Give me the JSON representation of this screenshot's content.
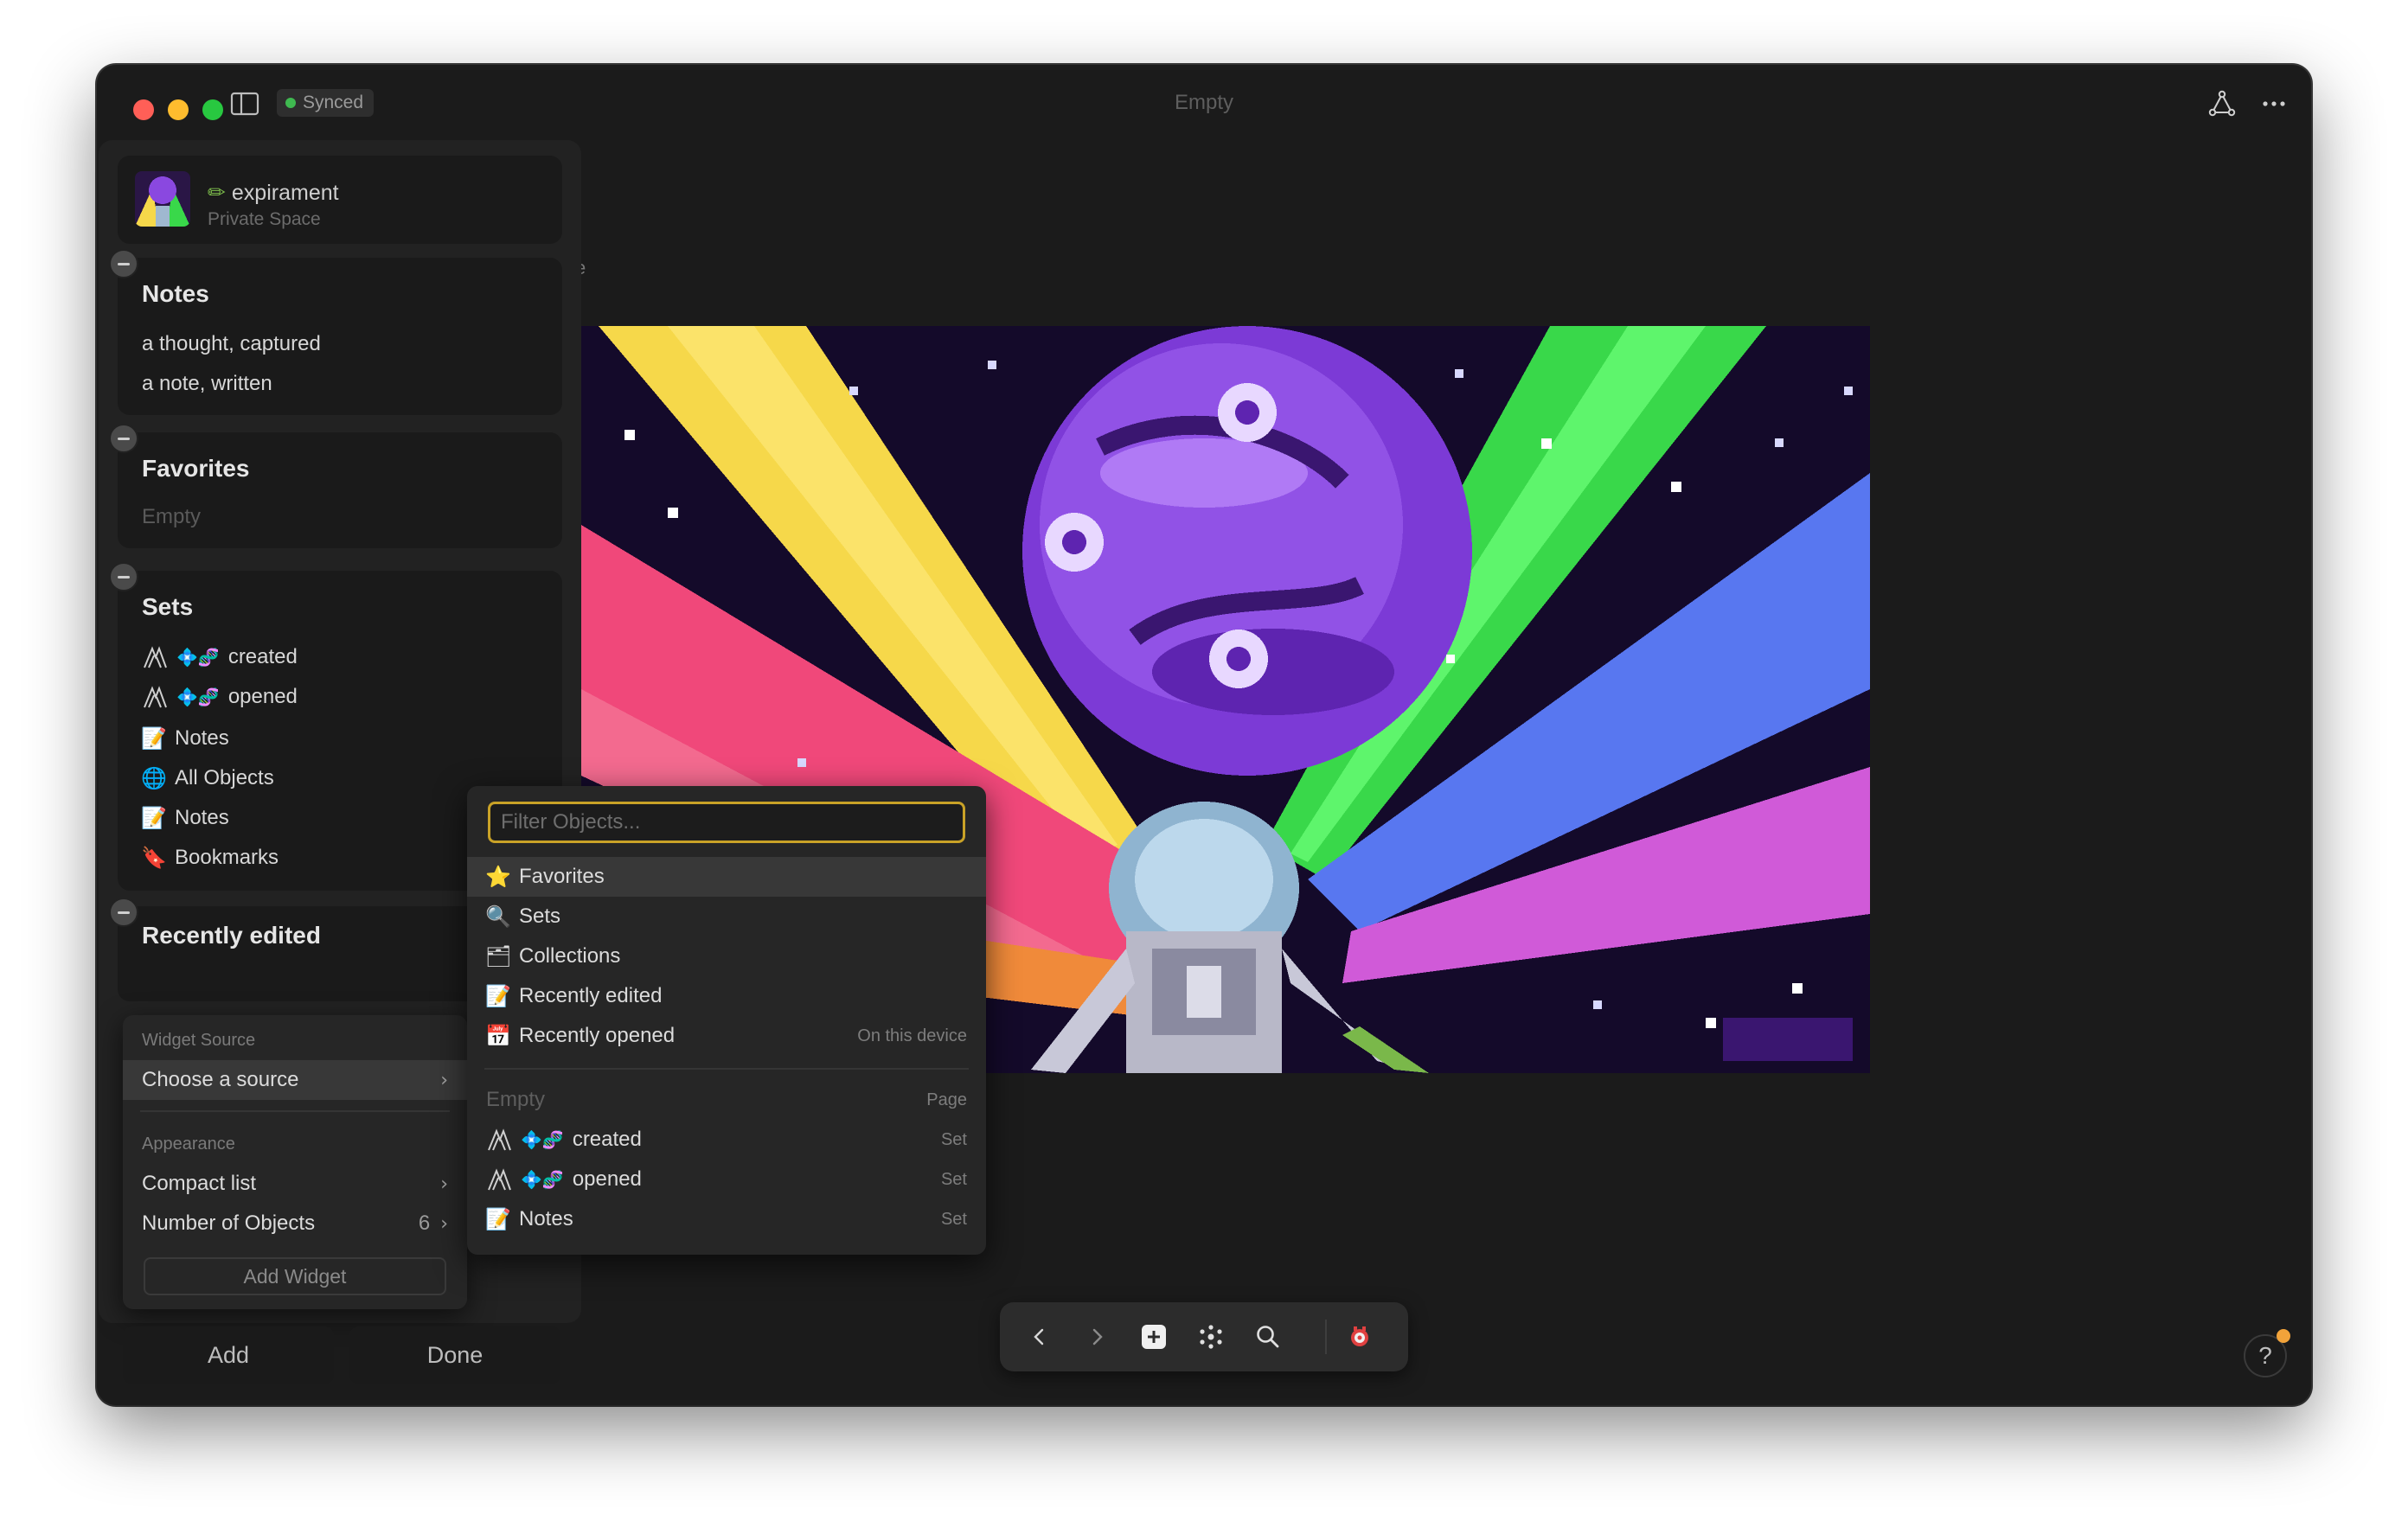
{
  "window": {
    "title": "Empty",
    "sync_status": "Synced"
  },
  "space": {
    "name": "expirament",
    "name_prefix": "✏",
    "subtitle": "Private Space"
  },
  "widgets": {
    "notes": {
      "title": "Notes",
      "items": [
        "a thought, captured",
        "a note, written"
      ]
    },
    "favorites": {
      "title": "Favorites",
      "empty_text": "Empty"
    },
    "sets": {
      "title": "Sets",
      "items": [
        {
          "icons": "💠🧬",
          "label": "created",
          "emoji": "📝"
        },
        {
          "icons": "💠🧬",
          "label": "opened",
          "emoji": "📝"
        },
        {
          "icons": "",
          "label": "Notes",
          "emoji": "📝"
        },
        {
          "icons": "",
          "label": "All Objects",
          "emoji": "🌐"
        },
        {
          "icons": "",
          "label": "Notes",
          "emoji": "📝"
        },
        {
          "icons": "",
          "label": "Bookmarks",
          "emoji": "🔖"
        }
      ]
    },
    "recently_edited": {
      "title": "Recently edited"
    }
  },
  "context_menu": {
    "section_source": "Widget Source",
    "choose_source": "Choose a source",
    "section_appearance": "Appearance",
    "compact_list": "Compact list",
    "number_of_objects": "Number of Objects",
    "number_of_objects_value": "6",
    "add_widget": "Add Widget"
  },
  "sidebar_buttons": {
    "add": "Add",
    "done": "Done"
  },
  "dropdown": {
    "filter_placeholder": "Filter Objects...",
    "system_items": [
      {
        "emoji": "⭐",
        "label": "Favorites",
        "meta": ""
      },
      {
        "emoji": "🔍",
        "label": "Sets",
        "meta": ""
      },
      {
        "emoji": "🗂",
        "label": "Collections",
        "meta": ""
      },
      {
        "emoji": "📝",
        "label": "Recently edited",
        "meta": ""
      },
      {
        "emoji": "📅",
        "label": "Recently opened",
        "meta": "On this device"
      }
    ],
    "object_items": [
      {
        "emoji": "",
        "label": "Empty",
        "meta": "Page"
      },
      {
        "emoji": "💠🧬",
        "label": "created",
        "meta": "Set"
      },
      {
        "emoji": "💠🧬",
        "label": "opened",
        "meta": "Set"
      },
      {
        "emoji": "📝",
        "label": "Notes",
        "meta": "Set"
      }
    ]
  },
  "toolbar": {
    "back_icon": "chevron-left-icon",
    "forward_icon": "chevron-right-icon",
    "create_icon": "plus-square-icon",
    "graph_icon": "graph-icon",
    "search_icon": "search-icon",
    "profile_icon": "profile-avatar-icon"
  },
  "help": {
    "label": "?"
  },
  "colors": {
    "window_bg": "#1b1b1b",
    "sidebar_bg": "#222222",
    "accent_focus": "#c9a227",
    "synced_green": "#3fb950",
    "notification_dot": "#f2a33a"
  }
}
